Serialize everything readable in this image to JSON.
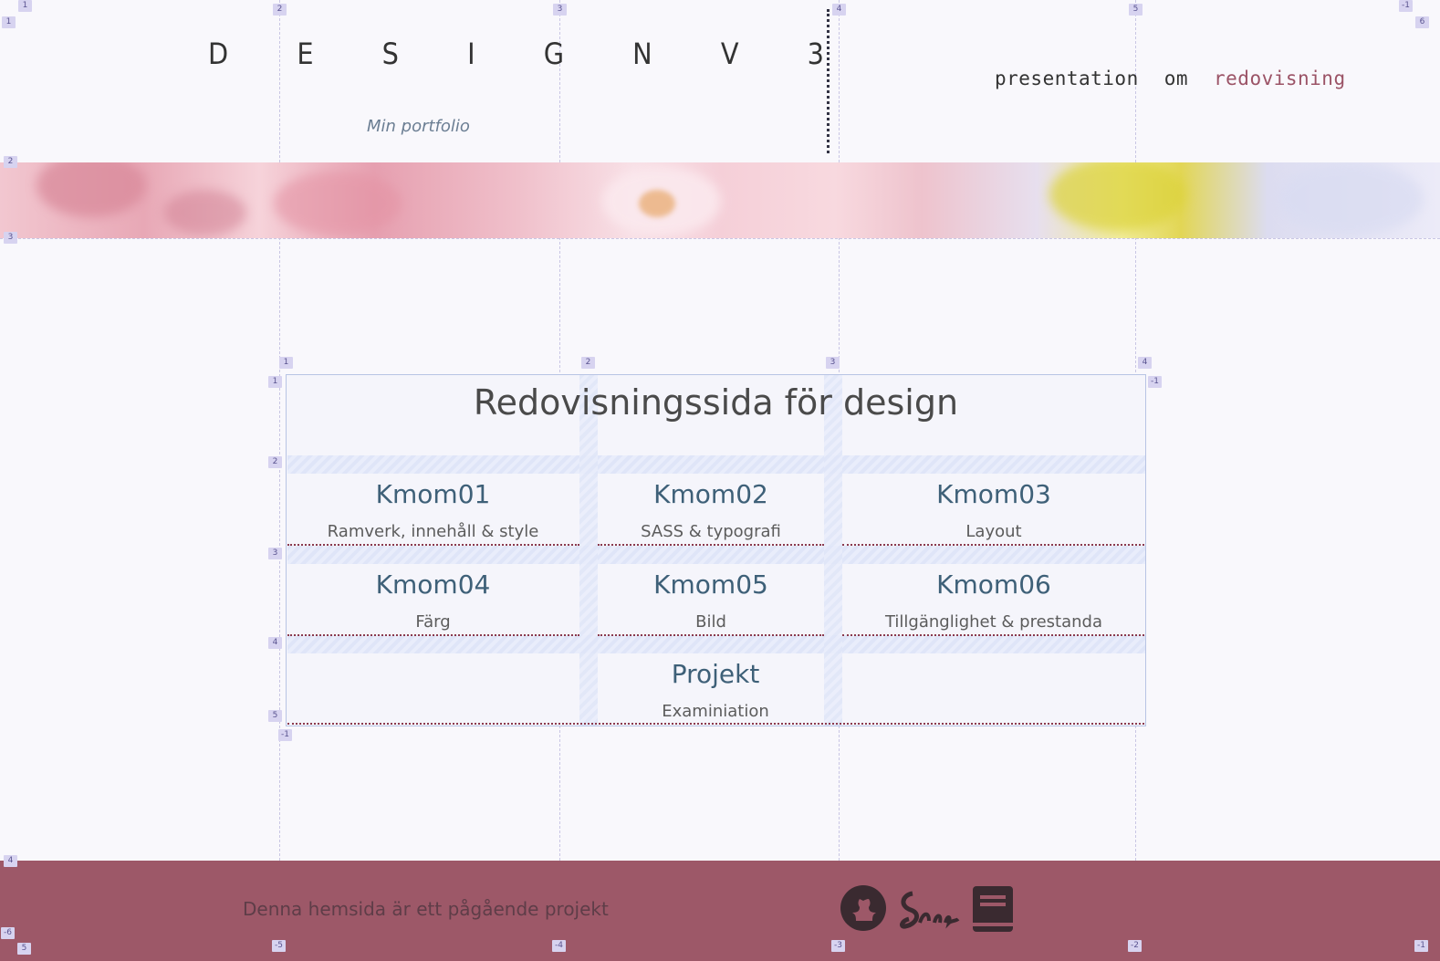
{
  "header": {
    "brand": "D E S I G N   V 3",
    "subtitle": "Min portfolio"
  },
  "nav": {
    "items": [
      {
        "label": "presentation"
      },
      {
        "label": "om"
      },
      {
        "label": "redovisning"
      }
    ]
  },
  "main": {
    "title": "Redovisningssida för design",
    "cells": [
      {
        "heading": "Kmom01",
        "description": "Ramverk, innehåll & style"
      },
      {
        "heading": "Kmom02",
        "description": "SASS & typografi"
      },
      {
        "heading": "Kmom03",
        "description": "Layout"
      },
      {
        "heading": "Kmom04",
        "description": "Färg"
      },
      {
        "heading": "Kmom05",
        "description": "Bild"
      },
      {
        "heading": "Kmom06",
        "description": "Tillgänglighet & prestanda"
      },
      {
        "heading": "Projekt",
        "description": "Examiniation"
      }
    ]
  },
  "footer": {
    "text": "Denna hemsida är ett pågående projekt",
    "icons": [
      "github-icon",
      "sass-icon",
      "book-icon"
    ]
  },
  "grid_overlay": {
    "page_columns": [
      "1",
      "2",
      "3",
      "4",
      "5",
      "-1",
      "6"
    ],
    "page_rows": [
      "1",
      "2",
      "3",
      "4",
      "5",
      "-6"
    ],
    "page_bottom": [
      "-5",
      "-4",
      "-3",
      "-2",
      "-1"
    ],
    "card_columns": [
      "1",
      "2",
      "3",
      "4",
      "-1"
    ],
    "card_rows": [
      "1",
      "2",
      "3",
      "4",
      "5",
      "-1"
    ]
  },
  "colors": {
    "accent": "#9d5868",
    "nav_active": "#9b5366",
    "heading": "#3e6078",
    "grid_badge": "#d7d3f0"
  }
}
